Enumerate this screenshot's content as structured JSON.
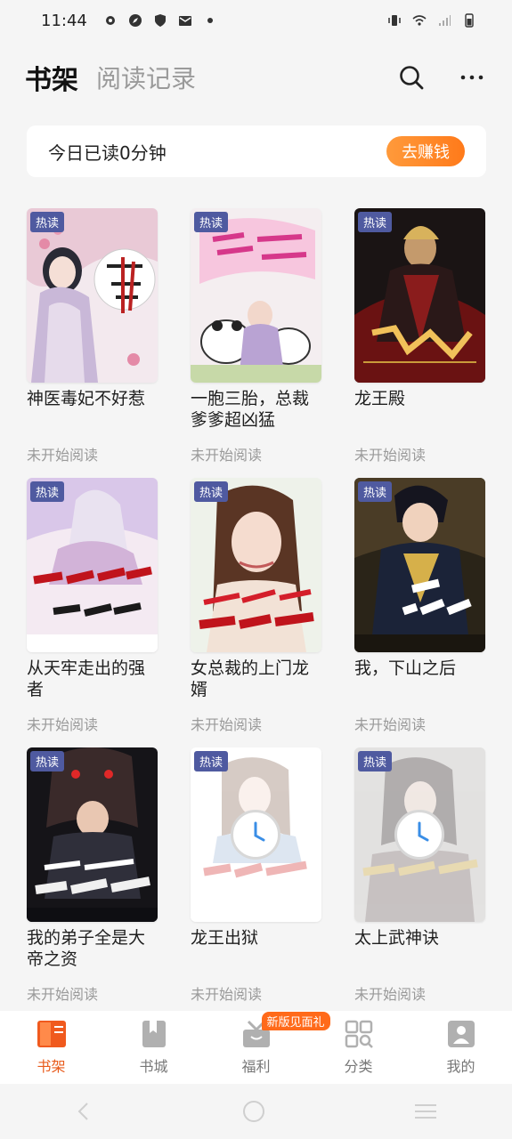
{
  "status_bar": {
    "time": "11:44"
  },
  "header": {
    "active_tab": "书架",
    "inactive_tab": "阅读记录",
    "search_icon": "search-icon",
    "more_icon": "more-icon"
  },
  "banner": {
    "text": "今日已读0分钟",
    "button": "去赚钱",
    "button_color": "#ff8a2a"
  },
  "books": [
    {
      "title": "神医毒妃不好惹",
      "tag": "热读",
      "status": "未开始阅读"
    },
    {
      "title": "一胞三胎，总裁爹爹超凶猛",
      "tag": "热读",
      "status": "未开始阅读"
    },
    {
      "title": "龙王殿",
      "tag": "热读",
      "status": "未开始阅读"
    },
    {
      "title": "从天牢走出的强者",
      "tag": "热读",
      "status": "未开始阅读"
    },
    {
      "title": "女总裁的上门龙婿",
      "tag": "热读",
      "status": "未开始阅读"
    },
    {
      "title": "我，下山之后",
      "tag": "热读",
      "status": "未开始阅读"
    },
    {
      "title": "我的弟子全是大帝之资",
      "tag": "热读",
      "status": "未开始阅读"
    },
    {
      "title": "龙王出狱",
      "tag": "热读",
      "status": "未开始阅读"
    },
    {
      "title": "太上武神诀",
      "tag": "热读",
      "status": "未开始阅读"
    }
  ],
  "bottom_nav": {
    "items": [
      {
        "label": "书架",
        "icon": "bookshelf-icon"
      },
      {
        "label": "书城",
        "icon": "bookstore-icon"
      },
      {
        "label": "福利",
        "icon": "gift-icon"
      },
      {
        "label": "分类",
        "icon": "category-icon"
      },
      {
        "label": "我的",
        "icon": "profile-icon"
      }
    ],
    "badge": "新版见面礼",
    "active_color": "#e85a1a"
  }
}
